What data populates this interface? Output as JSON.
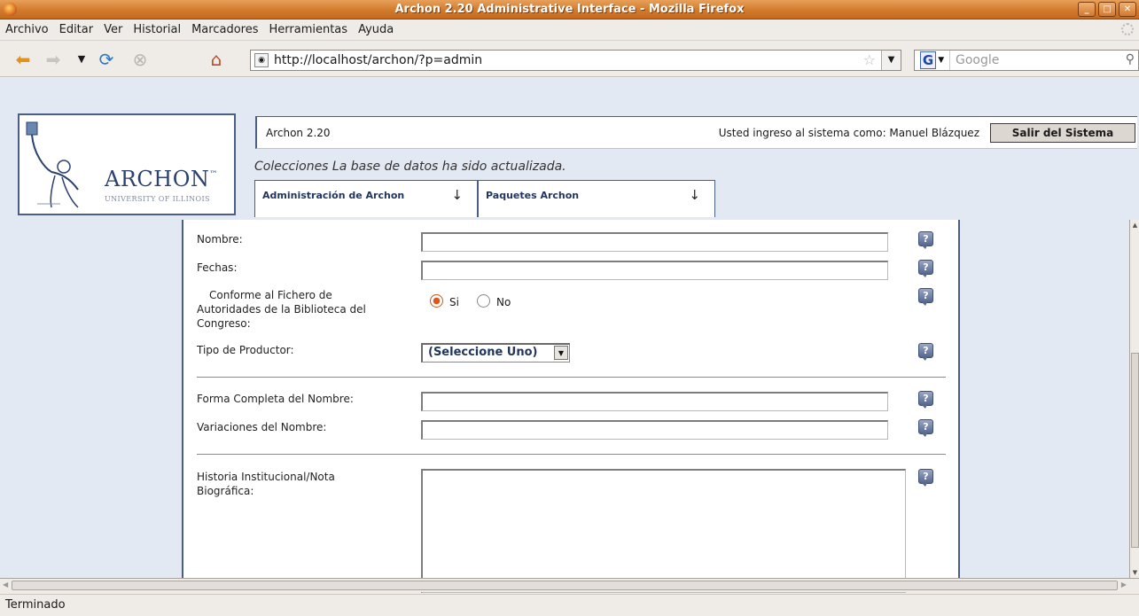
{
  "window": {
    "title": "Archon 2.20 Administrative Interface - Mozilla Firefox"
  },
  "menubar": [
    "Archivo",
    "Editar",
    "Ver",
    "Historial",
    "Marcadores",
    "Herramientas",
    "Ayuda"
  ],
  "navbar": {
    "url": "http://localhost/archon/?p=admin",
    "search_placeholder": "Google"
  },
  "header": {
    "logo_text": "ARCHON",
    "logo_tm": "™",
    "logo_sub": "UNIVERSITY OF ILLINOIS",
    "version": "Archon 2.20",
    "user_text": "Usted ingreso al sistema como: Manuel Blázquez",
    "logout_label": "Salir del Sistema",
    "status_message": "Colecciones La base de datos ha sido actualizada."
  },
  "tabs": [
    {
      "label": "Administración de Archon",
      "arrow": "↓"
    },
    {
      "label": "Paquetes Archon",
      "arrow": "↓"
    }
  ],
  "form": {
    "nombre_label": "Nombre:",
    "fechas_label": "Fechas:",
    "conforme_label_line1": "Conforme al Fichero de",
    "conforme_label_line2": "Autoridades de la Biblioteca del",
    "conforme_label_line3": "Congreso:",
    "radio_si": "Si",
    "radio_no": "No",
    "radio_selected": "Si",
    "tipo_label": "Tipo de Productor:",
    "tipo_value": "(Seleccione Uno)",
    "forma_label": "Forma Completa del Nombre:",
    "variaciones_label": "Variaciones del Nombre:",
    "historia_label_line1": "Historia Institucional/Nota",
    "historia_label_line2": "Biográfica:",
    "help_glyph": "?"
  },
  "status_bar": "Terminado"
}
